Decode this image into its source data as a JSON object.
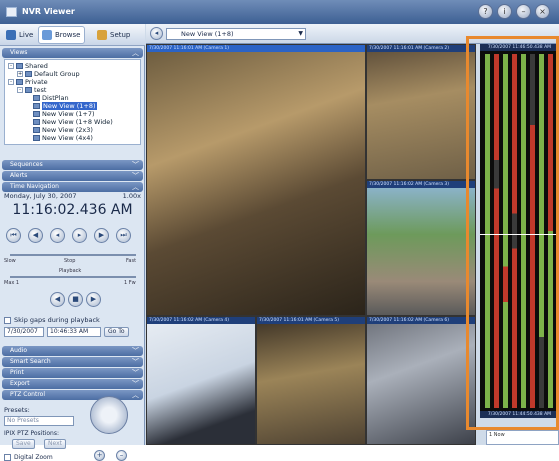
{
  "window": {
    "title": "NVR Viewer"
  },
  "nav": {
    "tabs": [
      {
        "label": "Live"
      },
      {
        "label": "Browse"
      },
      {
        "label": "Setup"
      }
    ]
  },
  "sections": {
    "views": "Views",
    "sequences": "Sequences",
    "alerts": "Alerts",
    "time_navigation": "Time Navigation",
    "audio": "Audio",
    "smart_search": "Smart Search",
    "print": "Print",
    "export": "Export",
    "ptz_control": "PTZ Control"
  },
  "tree": {
    "items": [
      {
        "label": "Shared",
        "box": "-"
      },
      {
        "label": "Default Group",
        "box": "+"
      },
      {
        "label": "Private",
        "box": "-"
      },
      {
        "label": "test",
        "box": "-"
      },
      {
        "label": "DistPlan"
      },
      {
        "label": "New View (1+8)",
        "selected": true
      },
      {
        "label": "New View (1+7)"
      },
      {
        "label": "New View (1+8 Wide)"
      },
      {
        "label": "New View (2x3)"
      },
      {
        "label": "New View (4x4)"
      }
    ]
  },
  "time_nav": {
    "date": "Monday, July 30, 2007",
    "speed": "1.00x",
    "clock": "11:16:02.436 AM",
    "speed_slider_labels": {
      "left": "Slow",
      "center": "Stop",
      "right": "Fast"
    },
    "playback_label": "Playback",
    "playback_slider_labels": {
      "left": "Max 1",
      "right": "1 Fw"
    },
    "skip_gaps_label": "Skip gaps during playback",
    "date_value": "7/30/2007",
    "time_value": "10:46:33 AM",
    "goto_label": "Go To"
  },
  "ptz": {
    "presets_label": "Presets:",
    "preset_select": "No Presets",
    "positions_label": "IPIX PTZ Positions:",
    "save_label": "Save",
    "next_label": "Next",
    "digital_zoom_label": "Digital Zoom"
  },
  "toolbar": {
    "view_name": "New View (1+8)"
  },
  "cameras": [
    {
      "header": "7/30/2007 11:16:01 AM (Camera 1)",
      "selected": true
    },
    {
      "header": "7/30/2007 11:16:01 AM (Camera 2)"
    },
    {
      "header": "7/30/2007 11:16:02 AM (Camera 3)"
    },
    {
      "header": "7/30/2007 11:16:02 AM (Camera 4)"
    },
    {
      "header": "7/30/2007 11:16:01 AM (Camera 5)"
    },
    {
      "header": "7/30/2007 11:16:02 AM (Camera 6)"
    }
  ],
  "timeline": {
    "header_top": "7/30/2007 11:46:50.438 AM",
    "header_bottom": "7/30/2007 11:44:50.438 AM",
    "colors": {
      "green": "#7db24a",
      "red": "#c0392b",
      "dark": "#3a3a3a"
    }
  },
  "status": {
    "line1": "1 Now",
    "line2": ""
  },
  "colors": {
    "highlight": "#e8892e",
    "accent": "#4c6ea3"
  }
}
